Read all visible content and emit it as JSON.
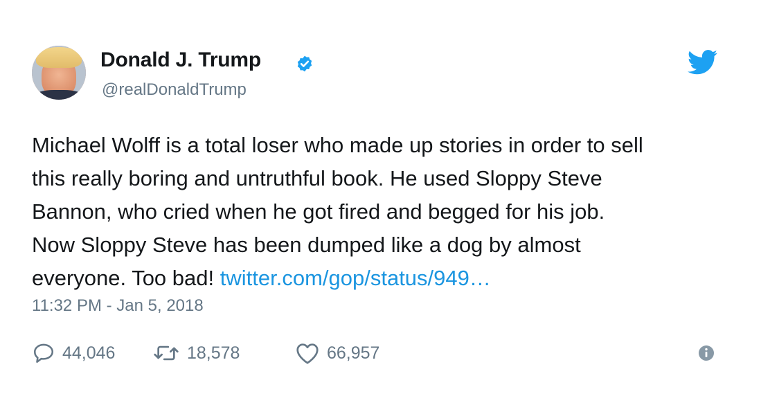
{
  "author": {
    "name": "Donald J. Trump",
    "handle": "@realDonaldTrump",
    "verified": true
  },
  "tweet": {
    "lines": [
      "Michael Wolff is a total loser who made up stories in order to sell",
      "this really boring and untruthful book. He used Sloppy Steve",
      "Bannon, who cried when he got fired and begged for his job.",
      "Now Sloppy Steve has been dumped like a dog by almost"
    ],
    "last_line_text": "everyone. Too bad!",
    "link": "twitter.com/gop/status/949…",
    "timestamp": "11:32 PM - Jan 5, 2018"
  },
  "actions": {
    "replies": "44,046",
    "retweets": "18,578",
    "likes": "66,957"
  },
  "icons": {
    "brand": "twitter-bird-icon",
    "verified": "verified-badge-icon",
    "reply": "reply-icon",
    "retweet": "retweet-icon",
    "like": "heart-icon",
    "info": "info-icon"
  },
  "colors": {
    "twitter_blue": "#1da1f2",
    "link": "#1b95e0",
    "secondary_text": "#657786",
    "primary_text": "#14171a"
  }
}
